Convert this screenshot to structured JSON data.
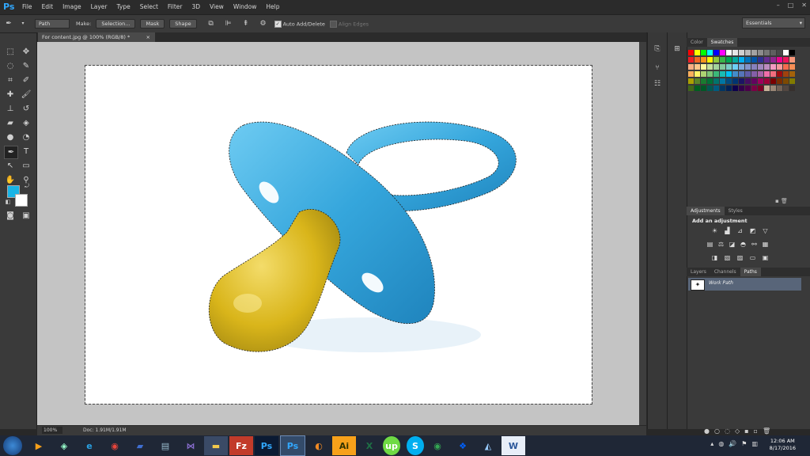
{
  "app": {
    "logo": "Ps"
  },
  "menu": [
    "File",
    "Edit",
    "Image",
    "Layer",
    "Type",
    "Select",
    "Filter",
    "3D",
    "View",
    "Window",
    "Help"
  ],
  "window_controls": {
    "min": "–",
    "max": "□",
    "close": "✕"
  },
  "options_bar": {
    "tool_icon": "pen-tool-icon",
    "mode_value": "Path",
    "make_label": "Make:",
    "selection_btn": "Selection...",
    "mask_btn": "Mask",
    "shape_btn": "Shape",
    "auto_add_delete": "Auto Add/Delete",
    "align_edges": "Align Edges",
    "workspace": "Essentials"
  },
  "document": {
    "tab_title": "For content.jpg @ 100% (RGB/8) *",
    "close": "×",
    "zoom": "100%",
    "doc_info": "Doc: 1.91M/1.91M"
  },
  "panels": {
    "color_tabs": [
      "Color",
      "Swatches"
    ],
    "adjust_tabs": [
      "Adjustments",
      "Styles"
    ],
    "add_adjustment": "Add an adjustment",
    "layer_tabs": [
      "Layers",
      "Channels",
      "Paths"
    ],
    "work_path": "Work Path"
  },
  "colors": {
    "foreground": "#19b4e6",
    "background": "#ffffff",
    "pacifier_blue": "#36a8dc",
    "pacifier_yellow": "#e0be1c"
  },
  "taskbar": {
    "time": "12:06 AM",
    "date": "8/17/2016",
    "icons": [
      "start",
      "media-player",
      "vmware",
      "ie",
      "chrome",
      "book",
      "notepad",
      "visual-studio",
      "explorer",
      "filezilla",
      "photoshop",
      "photoshop-active",
      "firefox",
      "illustrator",
      "excel",
      "upwork",
      "skype",
      "chrome-alt",
      "dropbox",
      "paint",
      "word"
    ]
  }
}
